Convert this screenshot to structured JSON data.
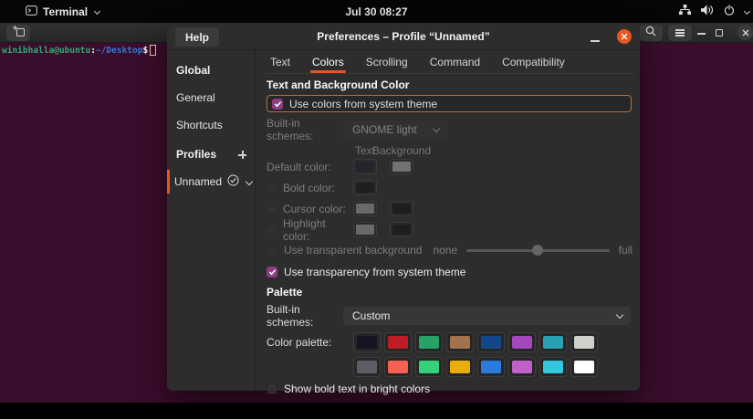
{
  "topbar": {
    "app_menu_label": "Terminal",
    "clock": "Jul 30 08:27"
  },
  "terminal": {
    "prompt_user_host": "winibhalla@ubuntu",
    "prompt_colon": ":",
    "prompt_path": "~/Desktop",
    "prompt_dollar": "$",
    "colors": {
      "background": "#3a0d2c",
      "user_host": "#33a873",
      "path": "#2a7bde",
      "text": "#ffffff"
    }
  },
  "dialog": {
    "title": "Preferences – Profile “Unnamed”",
    "help_button": "Help",
    "accent_color": "#e95420",
    "checkbox_checked_color": "#8c3c82",
    "sidebar": {
      "items": [
        {
          "label": "Global"
        },
        {
          "label": "General"
        },
        {
          "label": "Shortcuts"
        },
        {
          "label": "Profiles"
        },
        {
          "label": "Unnamed"
        }
      ]
    },
    "tabs": [
      {
        "label": "Text"
      },
      {
        "label": "Colors"
      },
      {
        "label": "Scrolling"
      },
      {
        "label": "Command"
      },
      {
        "label": "Compatibility"
      }
    ],
    "active_tab": "Colors",
    "colors_tab": {
      "section_title": "Text and Background Color",
      "use_system_theme_label": "Use colors from system theme",
      "builtin_schemes_label": "Built-in schemes:",
      "builtin_schemes_value": "GNOME light",
      "column_text": "Text",
      "column_background": "Background",
      "rows": {
        "default": {
          "label": "Default color:",
          "text_swatch": "#1d1b2b",
          "bg_swatch": "#c8c6c3"
        },
        "bold": {
          "label": "Bold color:",
          "swatch": "#101010"
        },
        "cursor": {
          "label": "Cursor color:",
          "text_swatch": "#b5b3b0",
          "bg_swatch": "#0e0e0e"
        },
        "highlight": {
          "label": "Highlight color:",
          "text_swatch": "#b5b3b0",
          "bg_swatch": "#0e0e0e"
        }
      },
      "transparent_bg_label": "Use transparent background",
      "transparent_none": "none",
      "transparent_full": "full",
      "slider_percent": 50,
      "transparency_system_label": "Use transparency from system theme",
      "palette_title": "Palette",
      "palette_builtin_label": "Built-in schemes:",
      "palette_builtin_value": "Custom",
      "palette_label": "Color palette:",
      "palette_row1": [
        "#171421",
        "#c01c28",
        "#26a269",
        "#a2734c",
        "#12488b",
        "#a347ba",
        "#2aa1b3",
        "#d0cfcc"
      ],
      "palette_row2": [
        "#5e5c64",
        "#f66151",
        "#33d17a",
        "#e9ad0c",
        "#2a7bde",
        "#c061cb",
        "#33c7de",
        "#ffffff"
      ],
      "bold_bright_label": "Show bold text in bright colors"
    }
  }
}
